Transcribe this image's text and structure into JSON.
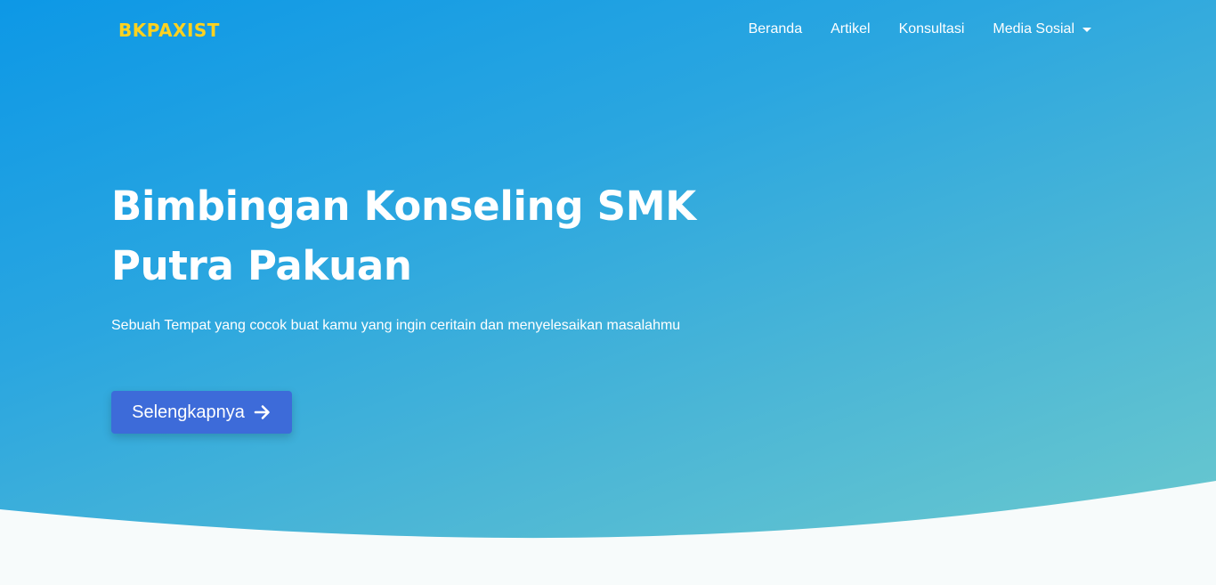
{
  "brand": {
    "name": "BKPAXIST",
    "color": "#ffd21f"
  },
  "nav": {
    "items": [
      {
        "label": "Beranda"
      },
      {
        "label": "Artikel"
      },
      {
        "label": "Konsultasi"
      },
      {
        "label": "Media Sosial",
        "dropdown": true
      }
    ]
  },
  "hero": {
    "title_line1": "Bimbingan Konseling SMK",
    "title_line2": "Putra Pakuan",
    "subtitle": "Sebuah Tempat yang cocok buat kamu yang ingin ceritain dan menyelesaikan masalahmu",
    "cta_label": "Selengkapnya",
    "cta_icon": "arrow-right-icon",
    "cta_color": "#3d6bd9"
  },
  "colors": {
    "gradient_start": "#0d98e6",
    "gradient_end": "#6ecbcd",
    "wave_fill": "#f7fbfb"
  }
}
